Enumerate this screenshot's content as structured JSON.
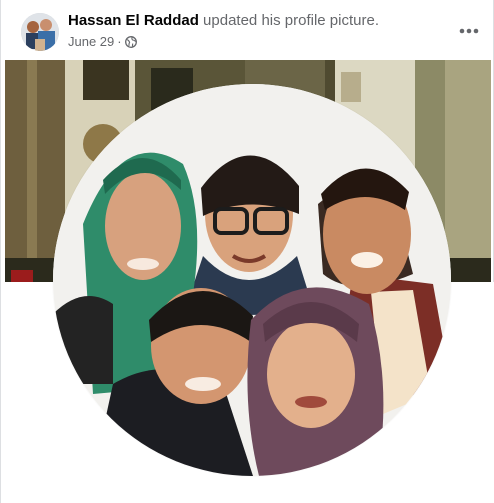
{
  "post": {
    "author_name": "Hassan El Raddad",
    "action_text": " updated his profile picture.",
    "date": "June 29",
    "separator": "·",
    "privacy_icon": "globe-icon",
    "more_icon": "more-options-icon"
  },
  "colors": {
    "name_text": "#050505",
    "secondary_text": "#65676b",
    "divider": "#dddfe2"
  }
}
